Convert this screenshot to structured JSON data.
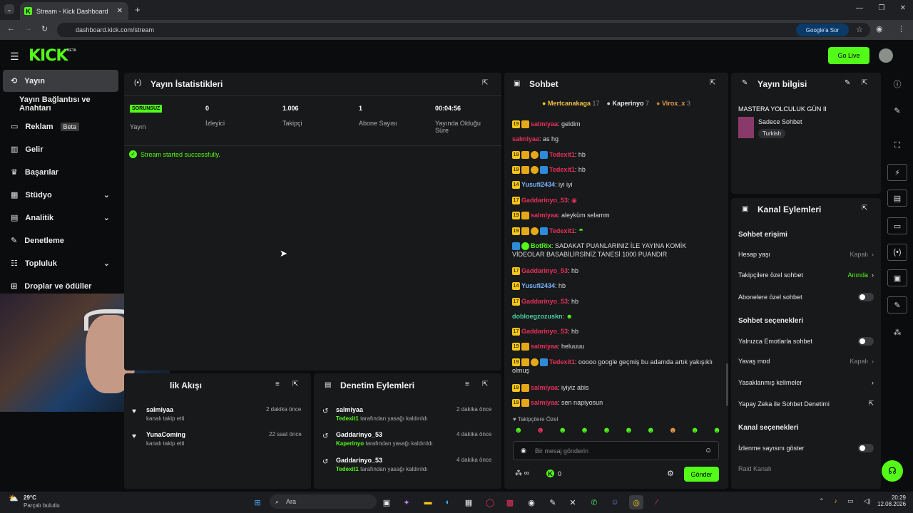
{
  "browser": {
    "tab_title": "Stream - Kick Dashboard",
    "url": "dashboard.kick.com/stream",
    "google_btn": "Google'a Sor"
  },
  "header": {
    "logo": "KICK",
    "beta": "BETA",
    "golive": "Go Live"
  },
  "sidebar": {
    "items": [
      {
        "label": "Yayın"
      },
      {
        "label": "Yayın Bağlantısı ve Anahtarı"
      },
      {
        "label": "Reklam",
        "badge": "Beta"
      },
      {
        "label": "Gelir"
      },
      {
        "label": "Başarılar"
      },
      {
        "label": "Stüdyo"
      },
      {
        "label": "Analitik"
      },
      {
        "label": "Denetleme"
      },
      {
        "label": "Topluluk"
      },
      {
        "label": "Droplar ve ödüller"
      }
    ]
  },
  "stats": {
    "title": "Yayın İstatistikleri",
    "status": "SORUNSUZ",
    "cols": [
      {
        "value": "",
        "label": "Yayın"
      },
      {
        "value": "0",
        "label": "İzleyici"
      },
      {
        "value": "1.006",
        "label": "Takipçi"
      },
      {
        "value": "1",
        "label": "Abone Sayısı"
      },
      {
        "value": "00:04:56",
        "label": "Yayında Olduğu Süre"
      }
    ],
    "message": "Stream started successfully."
  },
  "activity": {
    "title": "lik Akışı",
    "items": [
      {
        "user": "salmiyaa",
        "action": "kanalı takip etti",
        "time": "2 dakika önce"
      },
      {
        "user": "YunaComing",
        "action": "kanalı takip etti",
        "time": "22 saat önce"
      }
    ]
  },
  "moderation": {
    "title": "Denetim Eylemleri",
    "suffix": "tarafından yasağı kaldırıldı",
    "items": [
      {
        "user": "salmiyaa",
        "mod": "Tedexit1",
        "time": "2 dakika önce"
      },
      {
        "user": "Gaddarinyo_53",
        "mod": "Kaperinyo",
        "time": "4 dakika önce"
      },
      {
        "user": "Gaddarinyo_53",
        "mod": "Tedexit1",
        "time": "4 dakika önce"
      }
    ]
  },
  "chat": {
    "title": "Sohbet",
    "leaders": [
      {
        "name": "Mertcanakaga",
        "n": "17"
      },
      {
        "name": "Kaperinyo",
        "n": "7"
      },
      {
        "name": "Virox_x",
        "n": "3"
      }
    ],
    "lines": [
      {
        "user": "salmiyaa",
        "msg": "geldim",
        "lvl": "19"
      },
      {
        "user": "salmiyaa",
        "msg": "as hg",
        "lvl": ""
      },
      {
        "user": "Tedexit1",
        "msg": "hb",
        "lvl": "19"
      },
      {
        "user": "Tedexit1",
        "msg": "hb",
        "lvl": "19"
      },
      {
        "user": "Yusufi2434",
        "msg": "iyi iyi",
        "lvl": "14"
      },
      {
        "user": "Gaddarinyo_53",
        "msg": "",
        "lvl": "17"
      },
      {
        "user": "salmiyaa",
        "msg": "aleyküm selamm",
        "lvl": "19"
      },
      {
        "user": "Tedexit1",
        "msg": "",
        "lvl": "19"
      },
      {
        "user": "BotRix",
        "msg": "SADAKAT PUANLARINIZ İLE YAYINA KOMİK VİDEOLAR BASABİLİRSİNİZ TANESİ 1000 PUANDIR",
        "lvl": ""
      },
      {
        "user": "Gaddarinyo_53",
        "msg": "hb",
        "lvl": "17"
      },
      {
        "user": "Yusufi2434",
        "msg": "hb",
        "lvl": "14"
      },
      {
        "user": "Gaddarinyo_53",
        "msg": "hb",
        "lvl": "17"
      },
      {
        "user": "dobloegzozuskn",
        "msg": "",
        "lvl": ""
      },
      {
        "user": "Gaddarinyo_53",
        "msg": "hb",
        "lvl": "17"
      },
      {
        "user": "salmiyaa",
        "msg": "heluuuu",
        "lvl": "19"
      },
      {
        "user": "Tedexit1",
        "msg": "ooooo google geçmiş bu adamda artık yakışıklı olmuş",
        "lvl": "19"
      },
      {
        "user": "salmiyaa",
        "msg": "iyiyiz abis",
        "lvl": "19"
      },
      {
        "user": "salmiyaa",
        "msg": "sen napiyosun",
        "lvl": "19"
      }
    ],
    "followers_only": "Takipçilere Özel",
    "placeholder": "Bir mesaj gönderin",
    "points": "0",
    "send": "Gönder"
  },
  "info": {
    "title": "Yayın bilgisi",
    "stream_title": "MASTERA YOLCULUK GÜN II",
    "category": "Sadece Sohbet",
    "tag": "Turkish"
  },
  "actions": {
    "title": "Kanal Eylemleri",
    "access": "Sohbet erişimi",
    "account_age": "Hesap yaşı",
    "account_age_val": "Kapalı",
    "followers_chat": "Takipçilere özel sohbet",
    "followers_chat_val": "Anında",
    "subs_chat": "Abonelere özel sohbet",
    "options": "Sohbet seçenekleri",
    "emote_only": "Yalnızca Emotlarla sohbet",
    "slow": "Yavaş mod",
    "slow_val": "Kapalı",
    "banned_words": "Yasaklanmış kelimeler",
    "ai_mod": "Yapay Zeka ile Sohbet Denetimi",
    "channel_opts": "Kanal seçenekleri",
    "show_viewers": "İzlenme sayısını göster",
    "raid": "Raid Kanalı"
  },
  "taskbar": {
    "weather_temp": "29°C",
    "weather_desc": "Parçalı bulutlu",
    "search": "Ara",
    "time": "20:29",
    "date": "12.08.2026"
  }
}
